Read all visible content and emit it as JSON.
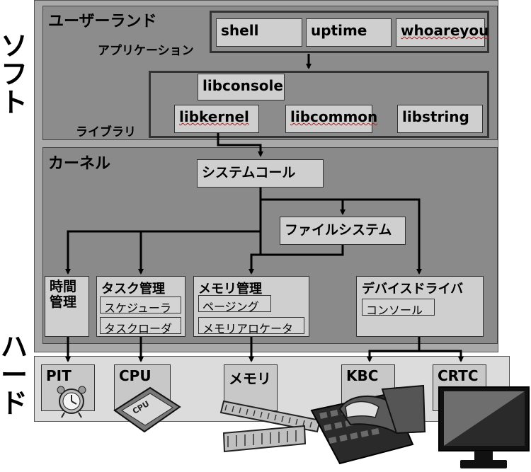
{
  "side_labels": {
    "software": "ソフト",
    "hardware": "ハード"
  },
  "userland": {
    "title": "ユーザーランド",
    "apps_label": "アプリケーション",
    "apps": [
      "shell",
      "uptime",
      "whoareyou"
    ],
    "libs_label": "ライブラリ",
    "libconsole": "libconsole",
    "libs": [
      "libkernel",
      "libcommon",
      "libstring"
    ]
  },
  "kernel": {
    "title": "カーネル",
    "syscall": "システムコール",
    "filesystem": "ファイルシステム",
    "timer": "時間\n管理",
    "task": {
      "title": "タスク管理",
      "subs": [
        "スケジューラ",
        "タスクローダ"
      ]
    },
    "memory": {
      "title": "メモリ管理",
      "subs": [
        "ページング",
        "メモリアロケータ"
      ]
    },
    "driver": {
      "title": "デバイスドライバ",
      "subs": [
        "コンソール"
      ]
    }
  },
  "hardware": {
    "pit": "PIT",
    "cpu": "CPU",
    "memory": "メモリ",
    "kbc": "KBC",
    "crtc": "CRTC",
    "chip_text": "CPU"
  },
  "colors": {
    "outer_bg": "#a9a9a9",
    "userland_bg": "#8c8c8c",
    "kernel_bg": "#8a8a8a",
    "box_bg": "#cfcfcf",
    "hw_bg": "#dcdcdc",
    "arrow": "#000000"
  }
}
